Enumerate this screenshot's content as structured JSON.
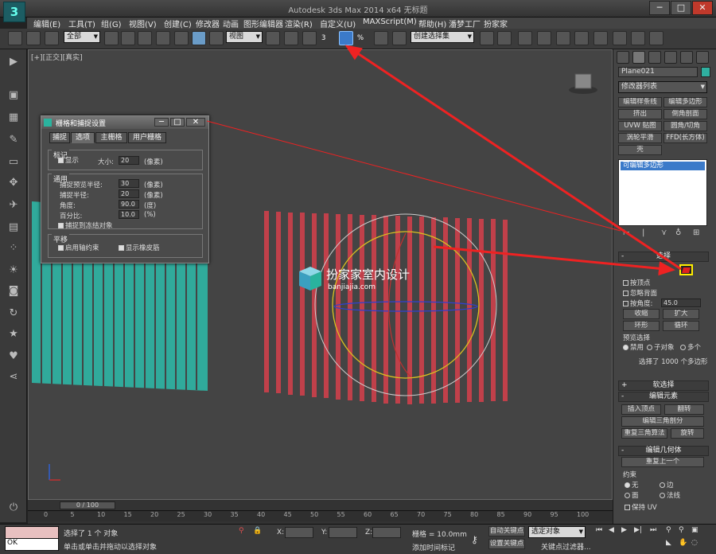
{
  "window": {
    "title": "Autodesk 3ds Max  2014 x64    无标题",
    "min": "─",
    "max": "□",
    "close": "✕"
  },
  "menu": [
    "编辑(E)",
    "工具(T)",
    "组(G)",
    "视图(V)",
    "创建(C)",
    "修改器",
    "动画",
    "图形编辑器",
    "渲染(R)",
    "自定义(U)",
    "MAXScript(M)",
    "帮助(H)",
    "潘梦工厂",
    "扮家家"
  ],
  "toolbar": {
    "filter_dropdown": "全部",
    "ref_coord_dropdown": "视图",
    "selection_set_dropdown": "创建选择集",
    "snap_label": "3",
    "percent_label": "%"
  },
  "viewport": {
    "label": "[+][正交][真实]",
    "watermark_title": "扮家家室内设计",
    "watermark_sub": "banjiajia.com",
    "colors": {
      "background": "#444444",
      "teal_object": "#2fb0a0",
      "red_object": "#c0404a"
    }
  },
  "dialog": {
    "title": "栅格和捕捉设置",
    "tabs": [
      "捕捉",
      "选项",
      "主栅格",
      "用户栅格"
    ],
    "active_tab": "选项",
    "marker_group": {
      "label": "标记",
      "display_label": "显示",
      "size_label": "大小:",
      "size_value": "20",
      "size_unit": "(像素)"
    },
    "general_group": {
      "label": "通用",
      "rows": [
        {
          "label": "捕捉预览半径:",
          "value": "30",
          "unit": "(像素)"
        },
        {
          "label": "捕捉半径:",
          "value": "20",
          "unit": "(像素)"
        },
        {
          "label": "角度:",
          "value": "90.0",
          "unit": "(度)"
        },
        {
          "label": "百分比:",
          "value": "10.0",
          "unit": "(%)"
        }
      ],
      "frozen_label": "捕捉到冻结对象"
    },
    "translate_group": {
      "label": "平移",
      "axis_label": "启用轴约束",
      "rubber_label": "显示橡皮筋"
    }
  },
  "right_panel": {
    "object_name": "Plane021",
    "object_color": "#2fb0a0",
    "modifier_list": "修改器列表",
    "modifier_buttons": [
      [
        "编辑样条线",
        "编辑多边形"
      ],
      [
        "挤出",
        "倒角剖面"
      ],
      [
        "UVW 贴图",
        "圆角/切角"
      ],
      [
        "涡轮平滑",
        "FFD(长方体)"
      ],
      [
        "壳",
        ""
      ]
    ],
    "stack_item": "可编辑多边形",
    "selection_rollout": "选择",
    "by_vertex": "按顶点",
    "ignore_backface": "忽略背面",
    "by_angle": "按角度:",
    "angle_value": "45.0",
    "shrink": "收缩",
    "grow": "扩大",
    "ring": "环形",
    "loop": "循环",
    "preview_label": "预览选择",
    "preview_options": [
      "禁用",
      "子对象",
      "多个"
    ],
    "selected_count": "选择了 1000 个多边形",
    "soft_selection": "软选择",
    "edit_elements": "编辑元素",
    "insert_vertex": "插入顶点",
    "flip": "翻转",
    "edit_triangulation": "编辑三角剖分",
    "retriangulate": "重复三角算法",
    "turn": "旋转",
    "edit_geometry": "编辑几何体",
    "repeat_last": "重复上一个",
    "constraints_label": "约束",
    "constraints": [
      "无",
      "边",
      "面",
      "法线"
    ],
    "preserve_uv": "保持 UV",
    "highlight_color": "#ffee00"
  },
  "timeline": {
    "slider": "0 / 100",
    "ticks": [
      "0",
      "5",
      "10",
      "15",
      "20",
      "25",
      "30",
      "35",
      "40",
      "45",
      "50",
      "55",
      "60",
      "65",
      "70",
      "75",
      "80",
      "85",
      "90",
      "95",
      "100"
    ]
  },
  "status": {
    "listener_text": "OK",
    "line1": "选择了 1 个 对象",
    "line2": "单击或单击并拖动以选择对象",
    "x_label": "X:",
    "y_label": "Y:",
    "z_label": "Z:",
    "grid": "栅格 = 10.0mm",
    "add_time_tag": "添加时间标记",
    "auto_key": "自动关键点",
    "set_key": "设置关键点",
    "key_filter_dropdown": "选定对象",
    "key_filters": "关键点过滤器..."
  }
}
